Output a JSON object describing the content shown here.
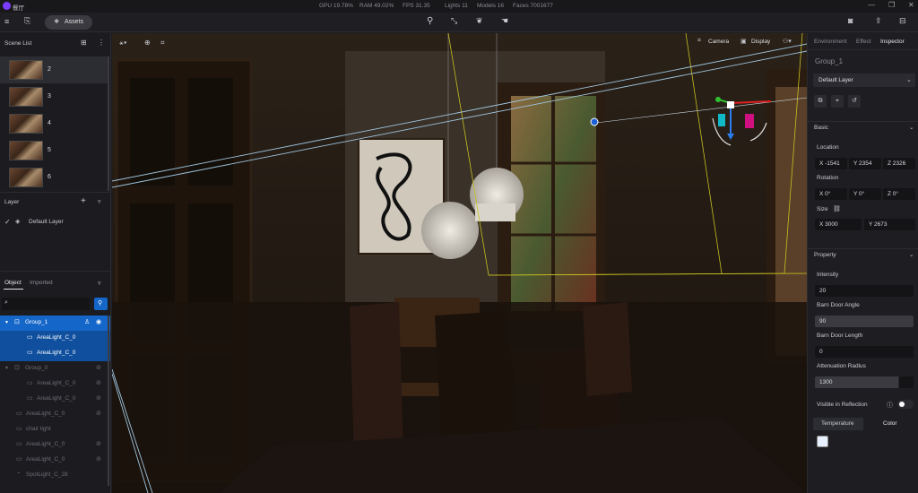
{
  "app": {
    "title": "餐厅"
  },
  "stats": {
    "gpu": "GPU 19.78%",
    "ram": "RAM 49.02%",
    "fps": "FPS 31.35",
    "lights": "Lights 11",
    "models": "Models 16",
    "faces": "Faces 7001677"
  },
  "toolbar": {
    "assets_label": "Assets"
  },
  "scene_list": {
    "title": "Scene List",
    "items": [
      {
        "num": "2"
      },
      {
        "num": "3"
      },
      {
        "num": "4"
      },
      {
        "num": "5"
      },
      {
        "num": "6"
      }
    ]
  },
  "layer": {
    "title": "Layer",
    "items": [
      {
        "label": "Default Layer",
        "checked": true
      }
    ]
  },
  "object_panel": {
    "tabs": [
      {
        "label": "Object"
      },
      {
        "label": "Imported"
      }
    ],
    "search": {
      "placeholder": "",
      "value": ""
    },
    "tree": [
      {
        "label": "Group_1",
        "selected": true,
        "level": 0,
        "type": "group",
        "expanded": true
      },
      {
        "label": "AreaLight_C_0",
        "selected": true,
        "level": 1
      },
      {
        "label": "AreaLight_C_0",
        "selected": true,
        "level": 1
      },
      {
        "label": "Group_0",
        "selected": false,
        "level": 0,
        "type": "group",
        "expanded": false
      },
      {
        "label": "AreaLight_C_0",
        "selected": false,
        "level": 1
      },
      {
        "label": "AreaLight_C_0",
        "selected": false,
        "level": 1
      },
      {
        "label": "AreaLight_C_0",
        "selected": false,
        "level": 0
      },
      {
        "label": "chair light",
        "selected": false,
        "level": 0
      },
      {
        "label": "AreaLight_C_0",
        "selected": false,
        "level": 0
      },
      {
        "label": "AreaLight_C_0",
        "selected": false,
        "level": 0
      },
      {
        "label": "SpotLight_C_28",
        "selected": false,
        "level": 0
      }
    ]
  },
  "viewport": {
    "camera_label": "Camera",
    "display_label": "Display"
  },
  "inspector": {
    "tabs": [
      {
        "label": "Environment"
      },
      {
        "label": "Effect"
      },
      {
        "label": "Inspector"
      }
    ],
    "object_name": "Group_1",
    "layer_select": "Default Layer",
    "basic": {
      "title": "Basic",
      "location_label": "Location",
      "location": {
        "x": "X -1541",
        "y": "Y 2354",
        "z": "Z 2326"
      },
      "rotation_label": "Rotation",
      "rotation": {
        "x": "X 0°",
        "y": "Y 0°",
        "z": "Z 0°"
      },
      "size_label": "Size",
      "size": {
        "x": "X 3000",
        "y": "Y 2673"
      }
    },
    "property": {
      "title": "Property",
      "intensity_label": "Intensity",
      "intensity": "20",
      "barn_angle_label": "Barn Door Angle",
      "barn_angle": "90",
      "barn_length_label": "Barn Door Length",
      "barn_length": "0",
      "attenuation_label": "Attenuation Radius",
      "attenuation": "1300",
      "visible_reflection_label": "Visible in Reflection",
      "visible_reflection": true,
      "temperature_label": "Temperature",
      "color_label": "Color",
      "color_value": "#e8f0ff"
    }
  },
  "colors": {
    "accent": "#1466c9",
    "selection": "#1466c9",
    "light_frame": "#c8c020",
    "beam": "#9fc6e0"
  }
}
